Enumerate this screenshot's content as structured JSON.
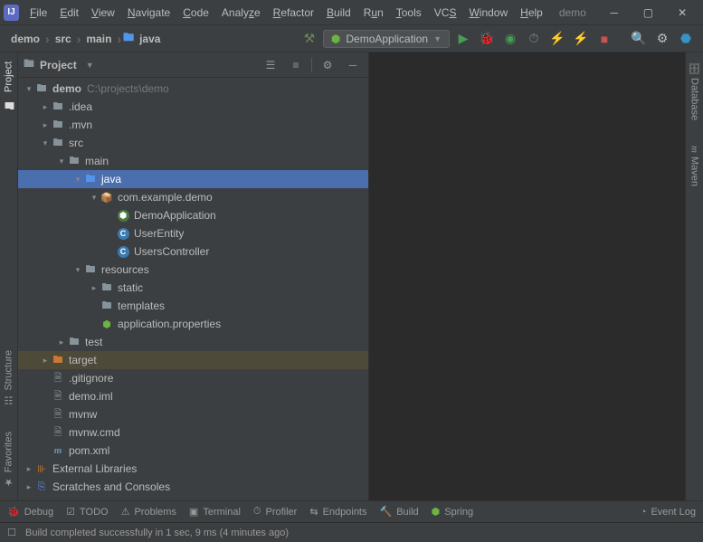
{
  "title": "demo",
  "menu": [
    "File",
    "Edit",
    "View",
    "Navigate",
    "Code",
    "Analyze",
    "Refactor",
    "Build",
    "Run",
    "Tools",
    "VCS",
    "Window",
    "Help"
  ],
  "breadcrumb": [
    "demo",
    "src",
    "main",
    "java"
  ],
  "runConfig": "DemoApplication",
  "panel": {
    "title": "Project"
  },
  "leftTabs": {
    "project": "Project",
    "structure": "Structure",
    "favorites": "Favorites"
  },
  "rightTabs": {
    "database": "Database",
    "maven": "Maven"
  },
  "tree": {
    "root": {
      "label": "demo",
      "hint": "C:\\projects\\demo"
    },
    "idea": ".idea",
    "mvn": ".mvn",
    "src": "src",
    "main": "main",
    "java": "java",
    "pkg": "com.example.demo",
    "c1": "DemoApplication",
    "c2": "UserEntity",
    "c3": "UsersController",
    "resources": "resources",
    "static": "static",
    "templates": "templates",
    "appprops": "application.properties",
    "test": "test",
    "target": "target",
    "gitignore": ".gitignore",
    "iml": "demo.iml",
    "mvnw": "mvnw",
    "mvnwcmd": "mvnw.cmd",
    "pom": "pom.xml",
    "extlib": "External Libraries",
    "scratches": "Scratches and Consoles"
  },
  "bottom": {
    "debug": "Debug",
    "todo": "TODO",
    "problems": "Problems",
    "terminal": "Terminal",
    "profiler": "Profiler",
    "endpoints": "Endpoints",
    "build": "Build",
    "spring": "Spring",
    "eventlog": "Event Log"
  },
  "status": "Build completed successfully in 1 sec, 9 ms (4 minutes ago)"
}
